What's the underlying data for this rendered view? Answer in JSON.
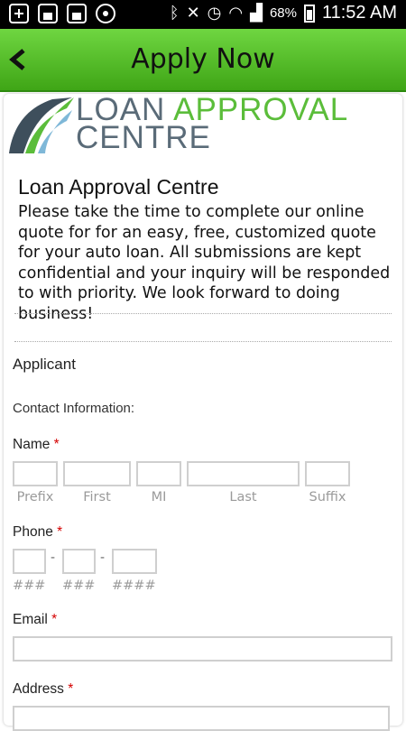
{
  "status_bar": {
    "battery": "68%",
    "time": "11:52 AM"
  },
  "header": {
    "title": "Apply Now"
  },
  "logo": {
    "line1_a": "LOAN ",
    "line1_b": "APPROVAL",
    "line2": "CENTRE"
  },
  "intro": {
    "title": "Loan Approval Centre",
    "body": "Please take the time to complete our online quote for for an easy, free, customized quote for your auto loan. All submissions are kept confidential and your inquiry will be responded to with priority. We look forward to doing business!"
  },
  "form": {
    "section": "Applicant",
    "contact_heading": "Contact Information:",
    "required_mark": "*",
    "name": {
      "label": "Name",
      "sublabels": {
        "prefix": "Prefix",
        "first": "First",
        "mi": "MI",
        "last": "Last",
        "suffix": "Suffix"
      }
    },
    "phone": {
      "label": "Phone",
      "separator": "-",
      "sublabels": {
        "area": "###",
        "prefix": "###",
        "line": "####"
      }
    },
    "email": {
      "label": "Email"
    },
    "address": {
      "label": "Address"
    }
  },
  "colors": {
    "header_green": "#4cb622",
    "required_red": "#d40000",
    "logo_gray": "#5a6b78",
    "logo_green": "#5bbd3a"
  }
}
